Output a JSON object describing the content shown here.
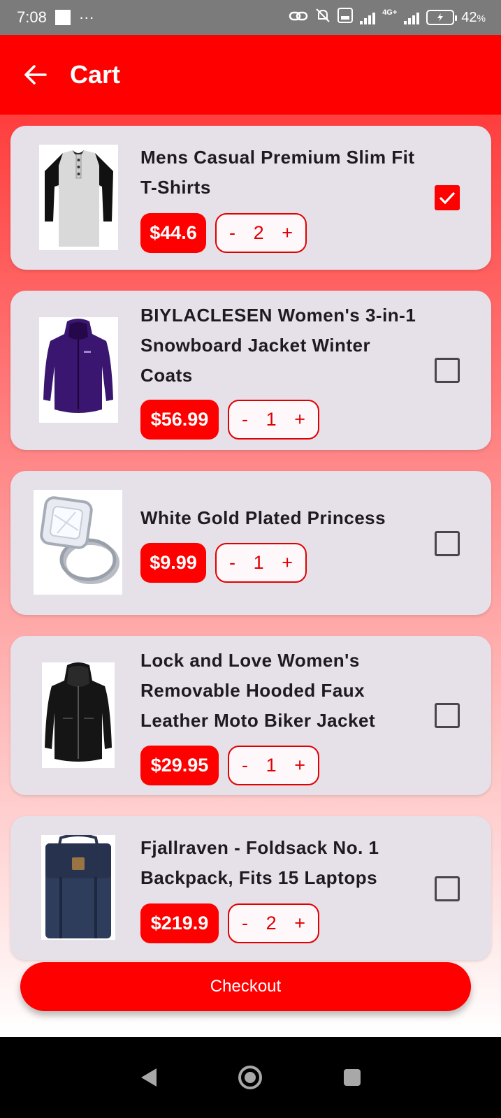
{
  "status_bar": {
    "time": "7:08",
    "more": "···",
    "network": "4G+",
    "battery": "42",
    "battery_unit": "%"
  },
  "app_bar": {
    "title": "Cart",
    "back_icon": "arrow-left-icon"
  },
  "cart": {
    "items": [
      {
        "title": "Mens Casual Premium Slim Fit T-Shirts",
        "price": "$44.6",
        "quantity": "2",
        "checked": true,
        "image": "tshirt-image"
      },
      {
        "title": "BIYLACLESEN Women's 3-in-1 Snowboard Jacket Winter Coats",
        "price": "$56.99",
        "quantity": "1",
        "checked": false,
        "image": "purple-jacket-image"
      },
      {
        "title": "White Gold Plated Princess",
        "price": "$9.99",
        "quantity": "1",
        "checked": false,
        "image": "ring-image"
      },
      {
        "title": "Lock and Love Women's Removable Hooded Faux Leather Moto Biker Jacket",
        "price": "$29.95",
        "quantity": "1",
        "checked": false,
        "image": "leather-jacket-image"
      },
      {
        "title": "Fjallraven - Foldsack No. 1 Backpack, Fits 15 Laptops",
        "price": "$219.9",
        "quantity": "2",
        "checked": false,
        "image": "backpack-image"
      }
    ],
    "decrement_label": "-",
    "increment_label": "+"
  },
  "checkout": {
    "label": "Checkout"
  },
  "colors": {
    "primary": "#fe0000",
    "card_bg": "#e6e0e8",
    "text": "#1d1b20"
  }
}
